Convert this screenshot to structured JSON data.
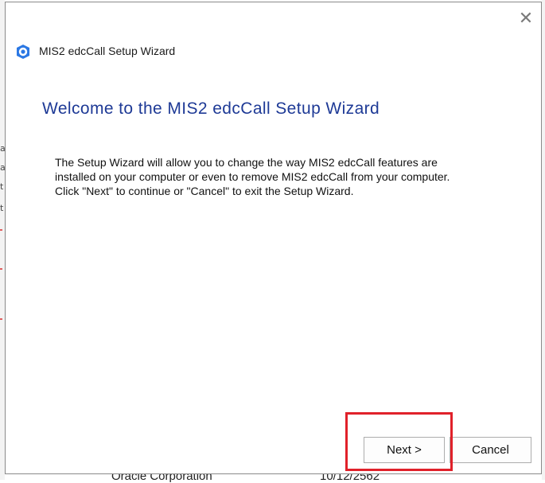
{
  "window": {
    "title": "MIS2 edcCall Setup Wizard",
    "close_glyph": "✕",
    "icon": "app-disc-icon"
  },
  "content": {
    "heading": "Welcome to the MIS2 edcCall Setup Wizard",
    "lines": [
      "The Setup Wizard will allow you to change the way MIS2 edcCall features are",
      "installed on your computer or even to remove MIS2 edcCall from your computer.",
      "Click \"Next\" to continue or \"Cancel\" to exit the Setup Wizard."
    ]
  },
  "buttons": {
    "next_label": "Next >",
    "cancel_label": "Cancel"
  },
  "annotation": {
    "highlight_color": "#e0212a",
    "target": "next-button"
  },
  "background": {
    "bottom_text": "Oracle Corporation",
    "bottom_date": "10/12/2562"
  },
  "colors": {
    "heading": "#1e3a96",
    "icon_blue": "#2b78e4"
  }
}
